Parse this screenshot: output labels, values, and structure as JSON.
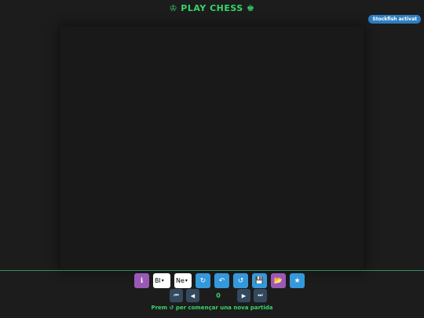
{
  "header": {
    "title": "♔ PLAY CHESS ♚"
  },
  "status": {
    "engine_badge": "Stockfish activat"
  },
  "toolbar": {
    "info_icon": "ℹ",
    "white_select": "Bl",
    "black_select": "Ne",
    "rotate_icon": "↻",
    "undo_icon": "↶",
    "restart_icon": "↺",
    "save_icon": "💾",
    "open_icon": "📂",
    "star_icon": "★"
  },
  "nav": {
    "first_icon": "⏮",
    "prev_icon": "◀",
    "move_count": "0",
    "next_icon": "▶",
    "last_icon": "⏭"
  },
  "footer": {
    "hint": "Prem ↺ per començar una nova partida"
  },
  "colors": {
    "accent": "#38d46a",
    "badge": "#2e7fc2",
    "button_blue": "#3598db",
    "button_purple": "#9b59b6",
    "nav_button": "#34495e"
  }
}
